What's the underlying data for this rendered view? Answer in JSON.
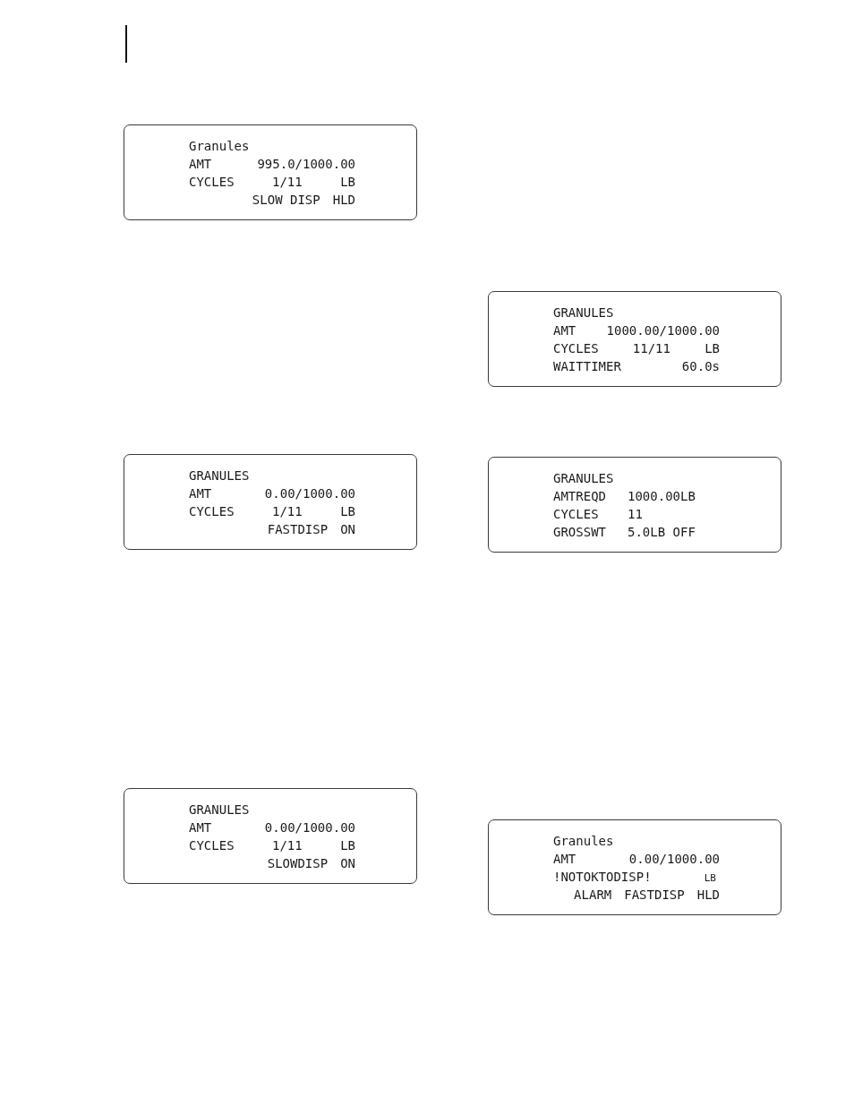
{
  "left_column": [
    {
      "kind": "progress",
      "lines": [
        {
          "kind": "title",
          "items": [
            "Granules"
          ]
        },
        {
          "kind": "field",
          "items": [
            "AMT",
            "995.0/1000.00"
          ]
        },
        {
          "kind": "field",
          "items": [
            "CYCLES",
            "1/11",
            "LB"
          ]
        },
        {
          "kind": "status",
          "items": [
            "SLOW DISP",
            "HLD"
          ]
        }
      ]
    },
    {
      "kind": "progress",
      "lines": [
        {
          "kind": "title",
          "items": [
            "GRANULES"
          ]
        },
        {
          "kind": "field",
          "items": [
            "AMT",
            "0.00/1000.00"
          ]
        },
        {
          "kind": "field",
          "items": [
            "CYCLES",
            "1/11",
            "LB"
          ]
        },
        {
          "kind": "status",
          "items": [
            "FASTDISP",
            "ON"
          ]
        }
      ]
    },
    {
      "kind": "progress",
      "lines": [
        {
          "kind": "title",
          "items": [
            "GRANULES"
          ]
        },
        {
          "kind": "field",
          "items": [
            "AMT",
            "0.00/1000.00"
          ]
        },
        {
          "kind": "field",
          "items": [
            "CYCLES",
            "1/11",
            "LB"
          ]
        },
        {
          "kind": "status",
          "items": [
            "SLOWDISP",
            "ON"
          ]
        }
      ]
    }
  ],
  "right_column": [
    {
      "kind": "progress",
      "lines": [
        {
          "kind": "title",
          "items": [
            "GRANULES"
          ]
        },
        {
          "kind": "field",
          "items": [
            "AMT",
            "1000.00/1000.00"
          ]
        },
        {
          "kind": "field",
          "items": [
            "CYCLES",
            "11/11",
            "LB"
          ]
        },
        {
          "kind": "field",
          "items": [
            "WAITTIMER",
            "60.0s"
          ]
        }
      ]
    },
    {
      "kind": "setup",
      "lines": [
        {
          "kind": "title",
          "items": [
            "GRANULES"
          ]
        },
        {
          "kind": "field",
          "items": [
            "AMTREQD",
            "1000.00LB"
          ]
        },
        {
          "kind": "field",
          "items": [
            "CYCLES",
            "11"
          ]
        },
        {
          "kind": "field",
          "items": [
            "GROSSWT",
            "5.0LB OFF"
          ]
        }
      ]
    },
    {
      "kind": "progress",
      "lines": [
        {
          "kind": "title",
          "items": [
            "Granules"
          ]
        },
        {
          "kind": "field",
          "items": [
            "AMT",
            "0.00/1000.00"
          ]
        },
        {
          "kind": "message",
          "items": [
            "!NOTOKTODISP!",
            "LB"
          ]
        },
        {
          "kind": "status",
          "items": [
            "ALARM",
            "FASTDISP",
            "HLD"
          ]
        }
      ]
    }
  ]
}
